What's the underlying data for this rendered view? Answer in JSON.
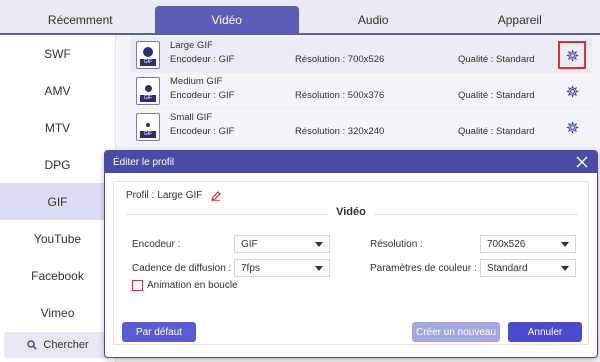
{
  "tabs": [
    {
      "label": "Récemment"
    },
    {
      "label": "Vidéo",
      "active": true
    },
    {
      "label": "Audio"
    },
    {
      "label": "Appareil"
    }
  ],
  "sidebar": {
    "items": [
      {
        "label": "SWF"
      },
      {
        "label": "AMV"
      },
      {
        "label": "MTV"
      },
      {
        "label": "DPG"
      },
      {
        "label": "GIF",
        "active": true
      },
      {
        "label": "YouTube"
      },
      {
        "label": "Facebook"
      },
      {
        "label": "Vimeo"
      }
    ],
    "search_label": "Chercher",
    "search_icon": "search-icon"
  },
  "formats": [
    {
      "name": "Large GIF",
      "encoder": "Encodeur : GIF",
      "resolution": "Résolution : 700x526",
      "quality": "Qualité : Standard",
      "icon_tag": "GIF"
    },
    {
      "name": "Medium GIF",
      "encoder": "Encodeur : GIF",
      "resolution": "Résolution : 500x376",
      "quality": "Qualité : Standard",
      "icon_tag": "GIF"
    },
    {
      "name": "Small GIF",
      "encoder": "Encodeur : GIF",
      "resolution": "Résolution : 320x240",
      "quality": "Qualité : Standard",
      "icon_tag": "GIF"
    }
  ],
  "dialog": {
    "title": "Éditer le profil",
    "profile_label": "Profil :",
    "profile_value": "Large GIF",
    "section": "Vidéo",
    "encoder_label": "Encodeur :",
    "encoder_value": "GIF",
    "framerate_label": "Cadence de diffusion :",
    "framerate_value": "7fps",
    "resolution_label": "Résolution :",
    "resolution_value": "700x526",
    "color_label": "Paramètres de couleur :",
    "color_value": "Standard",
    "loop_label": "Animation en boucle",
    "loop_checked": false,
    "default_button": "Par défaut",
    "create_button": "Créer un nouveau",
    "cancel_button": "Annuler"
  },
  "colors": {
    "accent": "#5b5bb8",
    "dialog_header": "#4b4ba6",
    "highlight": "#e0302f"
  }
}
